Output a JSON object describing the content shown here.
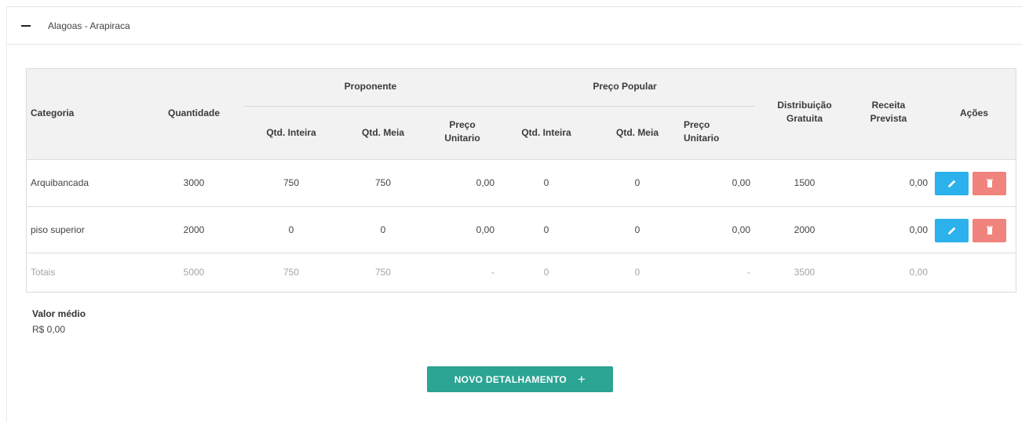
{
  "panel": {
    "title": "Alagoas - Arapiraca",
    "collapse_icon": "minus-icon"
  },
  "table": {
    "headers": {
      "categoria": "Categoria",
      "quantidade": "Quantidade",
      "proponente": "Proponente",
      "preco_popular": "Preço Popular",
      "distribuicao": "Distribuição Gratuita",
      "receita": "Receita Prevista",
      "acoes": "Ações",
      "qtd_inteira": "Qtd. Inteira",
      "qtd_meia": "Qtd. Meia",
      "preco_unitario": "Preço Unitario"
    },
    "rows": [
      {
        "categoria": "Arquibancada",
        "quantidade": "3000",
        "prop_inteira": "750",
        "prop_meia": "750",
        "prop_preco": "0,00",
        "pop_inteira": "0",
        "pop_meia": "0",
        "pop_preco": "0,00",
        "distribuicao": "1500",
        "receita": "0,00"
      },
      {
        "categoria": "piso superior",
        "quantidade": "2000",
        "prop_inteira": "0",
        "prop_meia": "0",
        "prop_preco": "0,00",
        "pop_inteira": "0",
        "pop_meia": "0",
        "pop_preco": "0,00",
        "distribuicao": "2000",
        "receita": "0,00"
      }
    ],
    "totals": {
      "categoria": "Totais",
      "quantidade": "5000",
      "prop_inteira": "750",
      "prop_meia": "750",
      "prop_preco": "-",
      "pop_inteira": "0",
      "pop_meia": "0",
      "pop_preco": "-",
      "distribuicao": "3500",
      "receita": "0,00"
    },
    "actions": {
      "edit_icon": "pencil-icon",
      "delete_icon": "trash-icon",
      "edit_color": "#2bb1eb",
      "delete_color": "#f0837d"
    }
  },
  "summary": {
    "label": "Valor médio",
    "value": "R$ 0,00"
  },
  "novo_button": {
    "label": "NOVO DETALHAMENTO",
    "icon": "+",
    "color": "#2ba493"
  }
}
